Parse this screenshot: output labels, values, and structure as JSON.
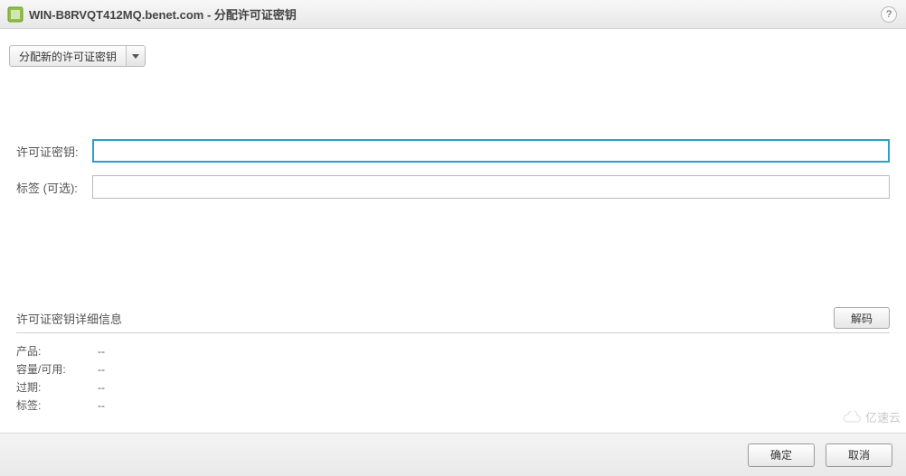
{
  "titlebar": {
    "host": "WIN-B8RVQT412MQ.benet.com",
    "separator": " - ",
    "subtitle": "分配许可证密钥"
  },
  "toolbar": {
    "assign_new_key_label": "分配新的许可证密钥"
  },
  "form": {
    "license_key_label": "许可证密钥:",
    "license_key_value": "",
    "tag_label": "标签 (可选):",
    "tag_value": ""
  },
  "details": {
    "header": "许可证密钥详细信息",
    "decode_label": "解码",
    "rows": [
      {
        "label": "产品:",
        "value": "--"
      },
      {
        "label": "容量/可用:",
        "value": "--"
      },
      {
        "label": "过期:",
        "value": "--"
      },
      {
        "label": "标签:",
        "value": "--"
      }
    ]
  },
  "footer": {
    "ok_label": "确定",
    "cancel_label": "取消"
  },
  "watermark": {
    "text": "亿速云"
  }
}
